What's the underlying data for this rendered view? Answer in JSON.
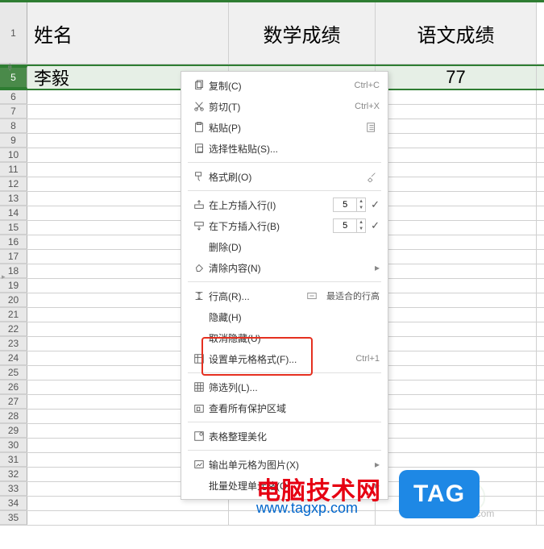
{
  "headers": {
    "colA": "姓名",
    "colB": "数学成绩",
    "colC": "语文成绩"
  },
  "rows": {
    "r1": "1",
    "r5": "5",
    "name5": "李毅",
    "score5C": "77",
    "small": [
      "6",
      "7",
      "8",
      "9",
      "10",
      "11",
      "12",
      "13",
      "14",
      "15",
      "16",
      "17",
      "18",
      "19",
      "20",
      "21",
      "22",
      "23",
      "24",
      "25",
      "26",
      "27",
      "28",
      "29",
      "30",
      "31",
      "32",
      "33",
      "34",
      "35"
    ]
  },
  "menu": {
    "copy": "复制(C)",
    "copy_sc": "Ctrl+C",
    "cut": "剪切(T)",
    "cut_sc": "Ctrl+X",
    "paste": "粘贴(P)",
    "paste_special": "选择性粘贴(S)...",
    "format_painter": "格式刷(O)",
    "insert_above": "在上方插入行(I)",
    "insert_above_n": "5",
    "insert_below": "在下方插入行(B)",
    "insert_below_n": "5",
    "delete": "删除(D)",
    "clear": "清除内容(N)",
    "row_height": "行高(R)...",
    "best_fit": "最适合的行高",
    "hide": "隐藏(H)",
    "unhide": "取消隐藏(U)",
    "cell_format": "设置单元格格式(F)...",
    "cell_format_sc": "Ctrl+1",
    "filter_col": "筛选列(L)...",
    "protect_area": "查看所有保护区域",
    "beautify": "表格整理美化",
    "output_cell": "输出单元格为图片(X)",
    "batch": "批量处理单元格(Q)"
  },
  "watermark": {
    "title": "电脑技术网",
    "url": "www.tagxp.com",
    "tag": "TAG",
    "site": "www.xz7.com"
  }
}
